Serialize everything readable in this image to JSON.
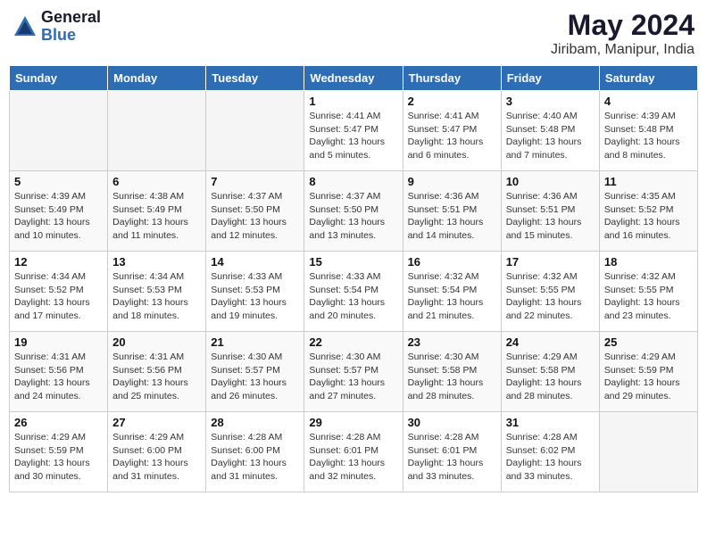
{
  "header": {
    "logo_general": "General",
    "logo_blue": "Blue",
    "month_year": "May 2024",
    "location": "Jiribam, Manipur, India"
  },
  "days_of_week": [
    "Sunday",
    "Monday",
    "Tuesday",
    "Wednesday",
    "Thursday",
    "Friday",
    "Saturday"
  ],
  "weeks": [
    [
      {
        "day": "",
        "info": ""
      },
      {
        "day": "",
        "info": ""
      },
      {
        "day": "",
        "info": ""
      },
      {
        "day": "1",
        "info": "Sunrise: 4:41 AM\nSunset: 5:47 PM\nDaylight: 13 hours\nand 5 minutes."
      },
      {
        "day": "2",
        "info": "Sunrise: 4:41 AM\nSunset: 5:47 PM\nDaylight: 13 hours\nand 6 minutes."
      },
      {
        "day": "3",
        "info": "Sunrise: 4:40 AM\nSunset: 5:48 PM\nDaylight: 13 hours\nand 7 minutes."
      },
      {
        "day": "4",
        "info": "Sunrise: 4:39 AM\nSunset: 5:48 PM\nDaylight: 13 hours\nand 8 minutes."
      }
    ],
    [
      {
        "day": "5",
        "info": "Sunrise: 4:39 AM\nSunset: 5:49 PM\nDaylight: 13 hours\nand 10 minutes."
      },
      {
        "day": "6",
        "info": "Sunrise: 4:38 AM\nSunset: 5:49 PM\nDaylight: 13 hours\nand 11 minutes."
      },
      {
        "day": "7",
        "info": "Sunrise: 4:37 AM\nSunset: 5:50 PM\nDaylight: 13 hours\nand 12 minutes."
      },
      {
        "day": "8",
        "info": "Sunrise: 4:37 AM\nSunset: 5:50 PM\nDaylight: 13 hours\nand 13 minutes."
      },
      {
        "day": "9",
        "info": "Sunrise: 4:36 AM\nSunset: 5:51 PM\nDaylight: 13 hours\nand 14 minutes."
      },
      {
        "day": "10",
        "info": "Sunrise: 4:36 AM\nSunset: 5:51 PM\nDaylight: 13 hours\nand 15 minutes."
      },
      {
        "day": "11",
        "info": "Sunrise: 4:35 AM\nSunset: 5:52 PM\nDaylight: 13 hours\nand 16 minutes."
      }
    ],
    [
      {
        "day": "12",
        "info": "Sunrise: 4:34 AM\nSunset: 5:52 PM\nDaylight: 13 hours\nand 17 minutes."
      },
      {
        "day": "13",
        "info": "Sunrise: 4:34 AM\nSunset: 5:53 PM\nDaylight: 13 hours\nand 18 minutes."
      },
      {
        "day": "14",
        "info": "Sunrise: 4:33 AM\nSunset: 5:53 PM\nDaylight: 13 hours\nand 19 minutes."
      },
      {
        "day": "15",
        "info": "Sunrise: 4:33 AM\nSunset: 5:54 PM\nDaylight: 13 hours\nand 20 minutes."
      },
      {
        "day": "16",
        "info": "Sunrise: 4:32 AM\nSunset: 5:54 PM\nDaylight: 13 hours\nand 21 minutes."
      },
      {
        "day": "17",
        "info": "Sunrise: 4:32 AM\nSunset: 5:55 PM\nDaylight: 13 hours\nand 22 minutes."
      },
      {
        "day": "18",
        "info": "Sunrise: 4:32 AM\nSunset: 5:55 PM\nDaylight: 13 hours\nand 23 minutes."
      }
    ],
    [
      {
        "day": "19",
        "info": "Sunrise: 4:31 AM\nSunset: 5:56 PM\nDaylight: 13 hours\nand 24 minutes."
      },
      {
        "day": "20",
        "info": "Sunrise: 4:31 AM\nSunset: 5:56 PM\nDaylight: 13 hours\nand 25 minutes."
      },
      {
        "day": "21",
        "info": "Sunrise: 4:30 AM\nSunset: 5:57 PM\nDaylight: 13 hours\nand 26 minutes."
      },
      {
        "day": "22",
        "info": "Sunrise: 4:30 AM\nSunset: 5:57 PM\nDaylight: 13 hours\nand 27 minutes."
      },
      {
        "day": "23",
        "info": "Sunrise: 4:30 AM\nSunset: 5:58 PM\nDaylight: 13 hours\nand 28 minutes."
      },
      {
        "day": "24",
        "info": "Sunrise: 4:29 AM\nSunset: 5:58 PM\nDaylight: 13 hours\nand 28 minutes."
      },
      {
        "day": "25",
        "info": "Sunrise: 4:29 AM\nSunset: 5:59 PM\nDaylight: 13 hours\nand 29 minutes."
      }
    ],
    [
      {
        "day": "26",
        "info": "Sunrise: 4:29 AM\nSunset: 5:59 PM\nDaylight: 13 hours\nand 30 minutes."
      },
      {
        "day": "27",
        "info": "Sunrise: 4:29 AM\nSunset: 6:00 PM\nDaylight: 13 hours\nand 31 minutes."
      },
      {
        "day": "28",
        "info": "Sunrise: 4:28 AM\nSunset: 6:00 PM\nDaylight: 13 hours\nand 31 minutes."
      },
      {
        "day": "29",
        "info": "Sunrise: 4:28 AM\nSunset: 6:01 PM\nDaylight: 13 hours\nand 32 minutes."
      },
      {
        "day": "30",
        "info": "Sunrise: 4:28 AM\nSunset: 6:01 PM\nDaylight: 13 hours\nand 33 minutes."
      },
      {
        "day": "31",
        "info": "Sunrise: 4:28 AM\nSunset: 6:02 PM\nDaylight: 13 hours\nand 33 minutes."
      },
      {
        "day": "",
        "info": ""
      }
    ]
  ]
}
